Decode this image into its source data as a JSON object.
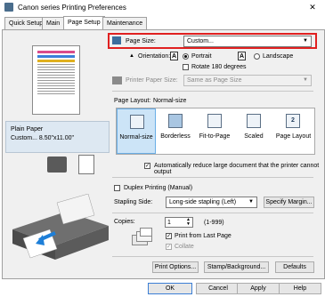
{
  "window": {
    "title": "Canon series Printing Preferences",
    "close_glyph": "✕"
  },
  "tabs": [
    "Quick Setup",
    "Main",
    "Page Setup",
    "Maintenance"
  ],
  "paper_info": {
    "line1": "Plain Paper",
    "line2": "Custom... 8.50\"x11.00\""
  },
  "page_size": {
    "label": "Page Size:",
    "value": "Custom..."
  },
  "orientation": {
    "label": "Orientation:",
    "portrait": "Portrait",
    "landscape": "Landscape",
    "rotate": "Rotate 180 degrees",
    "selected": "Portrait"
  },
  "printer_paper_size": {
    "label": "Printer Paper Size:",
    "value": "Same as Page Size"
  },
  "page_layout": {
    "label": "Page Layout:",
    "current": "Normal-size",
    "options": [
      "Normal-size",
      "Borderless",
      "Fit-to-Page",
      "Scaled",
      "Page Layout"
    ]
  },
  "auto_reduce": {
    "label": "Automatically reduce large document that the printer cannot output",
    "checked": true
  },
  "duplex": {
    "label": "Duplex Printing (Manual)",
    "checked": false
  },
  "stapling": {
    "label": "Stapling Side:",
    "value": "Long-side stapling (Left)",
    "margin_button": "Specify Margin..."
  },
  "copies": {
    "label": "Copies:",
    "value": "1",
    "range": "(1-999)"
  },
  "print_from_last": {
    "label": "Print from Last Page",
    "checked": true
  },
  "collate": {
    "label": "Collate",
    "checked": true
  },
  "option_buttons": [
    "Print Options...",
    "Stamp/Background...",
    "Defaults"
  ],
  "dialog_buttons": [
    "OK",
    "Cancel",
    "Apply",
    "Help"
  ],
  "colors": {
    "highlight": "#e02020",
    "selected_bg": "#cce4f7"
  }
}
